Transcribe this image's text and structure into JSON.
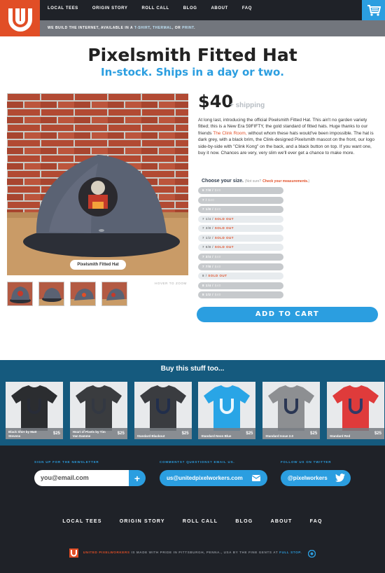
{
  "header": {
    "nav": [
      "LOCAL TEES",
      "ORIGIN STORY",
      "ROLL CALL",
      "BLOG",
      "ABOUT",
      "FAQ"
    ],
    "tagline_prefix": "WE BUILD THE INTERNET, AVAILABLE IN A",
    "tagline_t": "T-SHIRT",
    "tagline_sep": ",",
    "tagline_thermal": "THERMAL",
    "tagline_or": ", OR",
    "tagline_print": "PRINT",
    "tagline_end": "."
  },
  "product": {
    "title": "Pixelsmith Fitted Hat",
    "subtitle": "In-stock. Ships in a day or two.",
    "image_caption": "Pixelsmith Fitted Hat",
    "hover_zoom": "HOVER TO ZOOM",
    "price": "$40",
    "shipping": "+ shipping",
    "desc_1": "At long last, introducing the official Pixelsmith Fitted Hat. This ain't no garden variety fitted; this is a New Era 59FIFTY, the gold standard of fitted hats. Huge thanks to our friends",
    "desc_link": "The Clink Room,",
    "desc_2": "without whom these hats would've been impossible. The hat is dark grey, with a black brim, the Clink-designed Pixelsmith mascot on the front, our logo side-by-side with \"Clink Kong\" on the back, and a black button on top. If you want one, buy it now. Chances are very, very slim we'll ever get a chance to make more.",
    "choose_label": "Choose your size.",
    "not_sure": "(Not sure?",
    "check_measurements": "Check your measurements.",
    "close_paren": ")",
    "sizes": [
      {
        "size": "6 7/8 /",
        "tail": "$40",
        "sold_out": false
      },
      {
        "size": "7 /",
        "tail": "$40",
        "sold_out": false
      },
      {
        "size": "7 1/8 /",
        "tail": "$40",
        "sold_out": false
      },
      {
        "size": "7 1/4 /",
        "tail": "SOLD OUT",
        "sold_out": true
      },
      {
        "size": "7 3/8 /",
        "tail": "SOLD OUT",
        "sold_out": true
      },
      {
        "size": "7 1/2 /",
        "tail": "SOLD OUT",
        "sold_out": true
      },
      {
        "size": "7 5/8 /",
        "tail": "SOLD OUT",
        "sold_out": true
      },
      {
        "size": "7 3/4 /",
        "tail": "$40",
        "sold_out": false
      },
      {
        "size": "7 7/8 /",
        "tail": "$40",
        "sold_out": false
      },
      {
        "size": "8 /",
        "tail": "SOLD OUT",
        "sold_out": true
      },
      {
        "size": "8 1/4 /",
        "tail": "$40",
        "sold_out": false
      },
      {
        "size": "8 1/2 /",
        "tail": "$40",
        "sold_out": false
      }
    ],
    "add_to_cart": "ADD TO CART"
  },
  "related": {
    "title": "Buy this stuff too...",
    "items": [
      {
        "name": "Black Shirt by Matt Stevens",
        "price": "$25",
        "color": "#2b2d30"
      },
      {
        "name": "Heart of Pixels by Tim Van Damme",
        "price": "$25",
        "color": "#3a3c3f"
      },
      {
        "name": "Standard Blackout",
        "price": "$25",
        "color": "#3a3c40"
      },
      {
        "name": "Standard Neon Blue",
        "price": "$25",
        "color": "#29a5e6"
      },
      {
        "name": "Standard Issue 2.0",
        "price": "$25",
        "color": "#8d8f92"
      },
      {
        "name": "Standard Red",
        "price": "$25",
        "color": "#df3b3b"
      }
    ]
  },
  "footer": {
    "newsletter_label": "SIGN UP FOR THE NEWSLETTER",
    "email_placeholder": "you@email.com",
    "contact_label": "COMMENTS? QUESTIONS? EMAIL US.",
    "contact_email": "us@unitedpixelworkers.com",
    "twitter_label": "FOLLOW US ON TWITTER",
    "twitter_handle": "@pixelworkers",
    "nav": [
      "LOCAL TEES",
      "ORIGIN STORY",
      "ROLL CALL",
      "BLOG",
      "ABOUT",
      "FAQ"
    ],
    "credit_brand": "UNITED PIXELWORKERS",
    "credit_text": "IS MADE WITH PRIDE IN PITTSBURGH, PENNA., USA BY THE FINE GENTS AT",
    "credit_fs": "FULL STOP",
    "credit_end": "."
  },
  "colors": {
    "brand_orange": "#e14e26",
    "accent_blue": "#2b9ee0",
    "dark": "#1f2228"
  }
}
